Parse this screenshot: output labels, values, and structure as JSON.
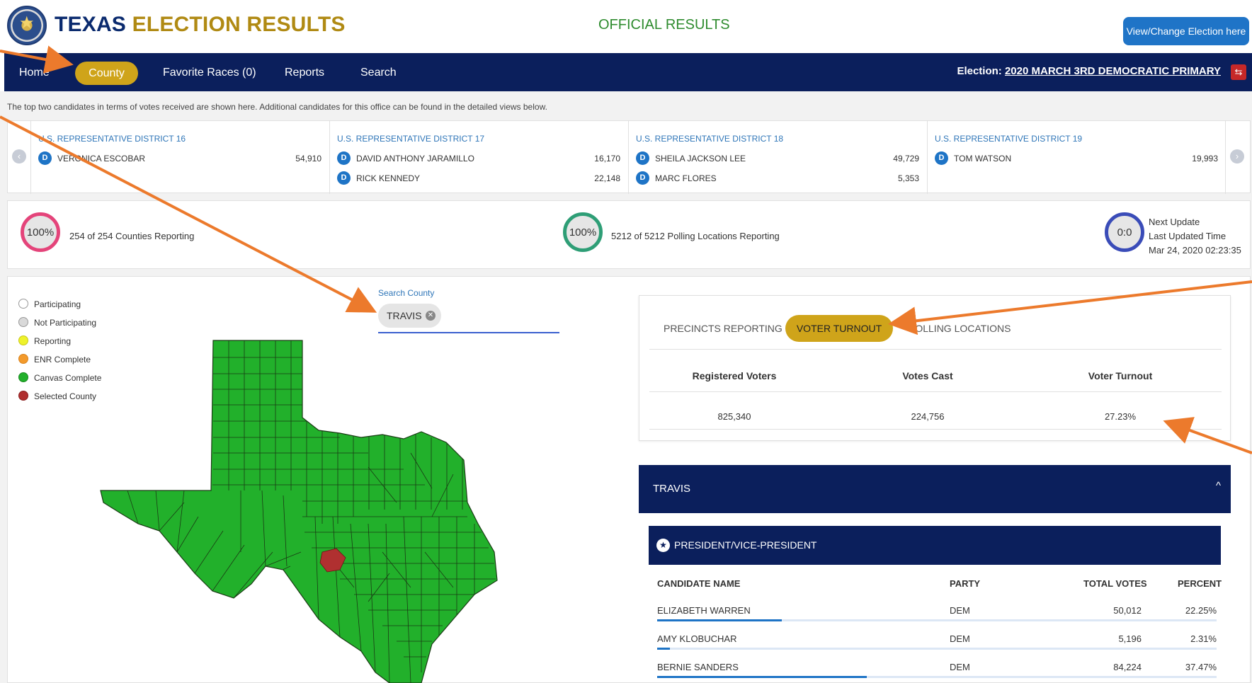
{
  "header": {
    "brand_part1": "TEXAS",
    "brand_part2": "ELECTION RESULTS",
    "official_label": "OFFICIAL RESULTS",
    "view_change_label": "View/Change Election here"
  },
  "nav": {
    "items": [
      {
        "label": "Home"
      },
      {
        "label": "County",
        "active": true
      },
      {
        "label": "Favorite Races (0)"
      },
      {
        "label": "Reports"
      },
      {
        "label": "Search"
      }
    ],
    "election_prefix": "Election:",
    "election_name": "2020 MARCH 3RD DEMOCRATIC PRIMARY"
  },
  "info_text": "The top two candidates in terms of votes received are shown here. Additional candidates for this office can be found in the detailed views below.",
  "carousel": {
    "races": [
      {
        "title": "U.S. REPRESENTATIVE DISTRICT 16",
        "candidates": [
          {
            "party": "D",
            "name": "VERONICA ESCOBAR",
            "votes": "54,910"
          }
        ]
      },
      {
        "title": "U.S. REPRESENTATIVE DISTRICT 17",
        "candidates": [
          {
            "party": "D",
            "name": "DAVID ANTHONY JARAMILLO",
            "votes": "16,170"
          },
          {
            "party": "D",
            "name": "RICK KENNEDY",
            "votes": "22,148"
          }
        ]
      },
      {
        "title": "U.S. REPRESENTATIVE DISTRICT 18",
        "candidates": [
          {
            "party": "D",
            "name": "SHEILA JACKSON LEE",
            "votes": "49,729"
          },
          {
            "party": "D",
            "name": "MARC FLORES",
            "votes": "5,353"
          }
        ]
      },
      {
        "title": "U.S. REPRESENTATIVE DISTRICT 19",
        "candidates": [
          {
            "party": "D",
            "name": "TOM WATSON",
            "votes": "19,993"
          }
        ]
      }
    ]
  },
  "stats": {
    "counties": {
      "percent": "100%",
      "text": "254 of 254 Counties Reporting",
      "color": "#e4447a"
    },
    "polling": {
      "percent": "100%",
      "text": "5212 of 5212 Polling Locations Reporting",
      "color": "#2e9e76"
    },
    "timer": {
      "value": "0:0",
      "color": "#3a4cb8"
    },
    "next_update_label": "Next Update",
    "last_updated_label": "Last Updated Time",
    "last_updated_time": "Mar 24, 2020 02:23:35"
  },
  "legend": [
    {
      "label": "Participating",
      "color": "#ffffff"
    },
    {
      "label": "Not Participating",
      "color": "#d9d9d9"
    },
    {
      "label": "Reporting",
      "color": "#eef22b"
    },
    {
      "label": "ENR Complete",
      "color": "#f39a2b"
    },
    {
      "label": "Canvas Complete",
      "color": "#22b02b"
    },
    {
      "label": "Selected County",
      "color": "#b03030"
    }
  ],
  "search": {
    "label": "Search County",
    "chip": "TRAVIS"
  },
  "turnout": {
    "tabs": [
      "PRECINCTS REPORTING",
      "VOTER TURNOUT",
      "POLLING LOCATIONS"
    ],
    "active_tab": "VOTER TURNOUT",
    "columns": [
      "Registered Voters",
      "Votes Cast",
      "Voter Turnout"
    ],
    "values": [
      "825,340",
      "224,756",
      "27.23%"
    ]
  },
  "county_panel": {
    "title": "TRAVIS",
    "race_title": "PRESIDENT/VICE-PRESIDENT",
    "columns": [
      "CANDIDATE NAME",
      "PARTY",
      "TOTAL VOTES",
      "PERCENT"
    ],
    "rows": [
      {
        "name": "ELIZABETH WARREN",
        "party": "DEM",
        "votes": "50,012",
        "percent": "22.25%",
        "share": 0.2225
      },
      {
        "name": "AMY KLOBUCHAR",
        "party": "DEM",
        "votes": "5,196",
        "percent": "2.31%",
        "share": 0.0231
      },
      {
        "name": "BERNIE SANDERS",
        "party": "DEM",
        "votes": "84,224",
        "percent": "37.47%",
        "share": 0.3747
      }
    ]
  },
  "colors": {
    "navy": "#0b1f5c",
    "gold": "#cfa41a",
    "blue": "#1e74c6",
    "map_green": "#22b02b",
    "selected_red": "#b03030",
    "annotation_orange": "#ec7a2c"
  }
}
